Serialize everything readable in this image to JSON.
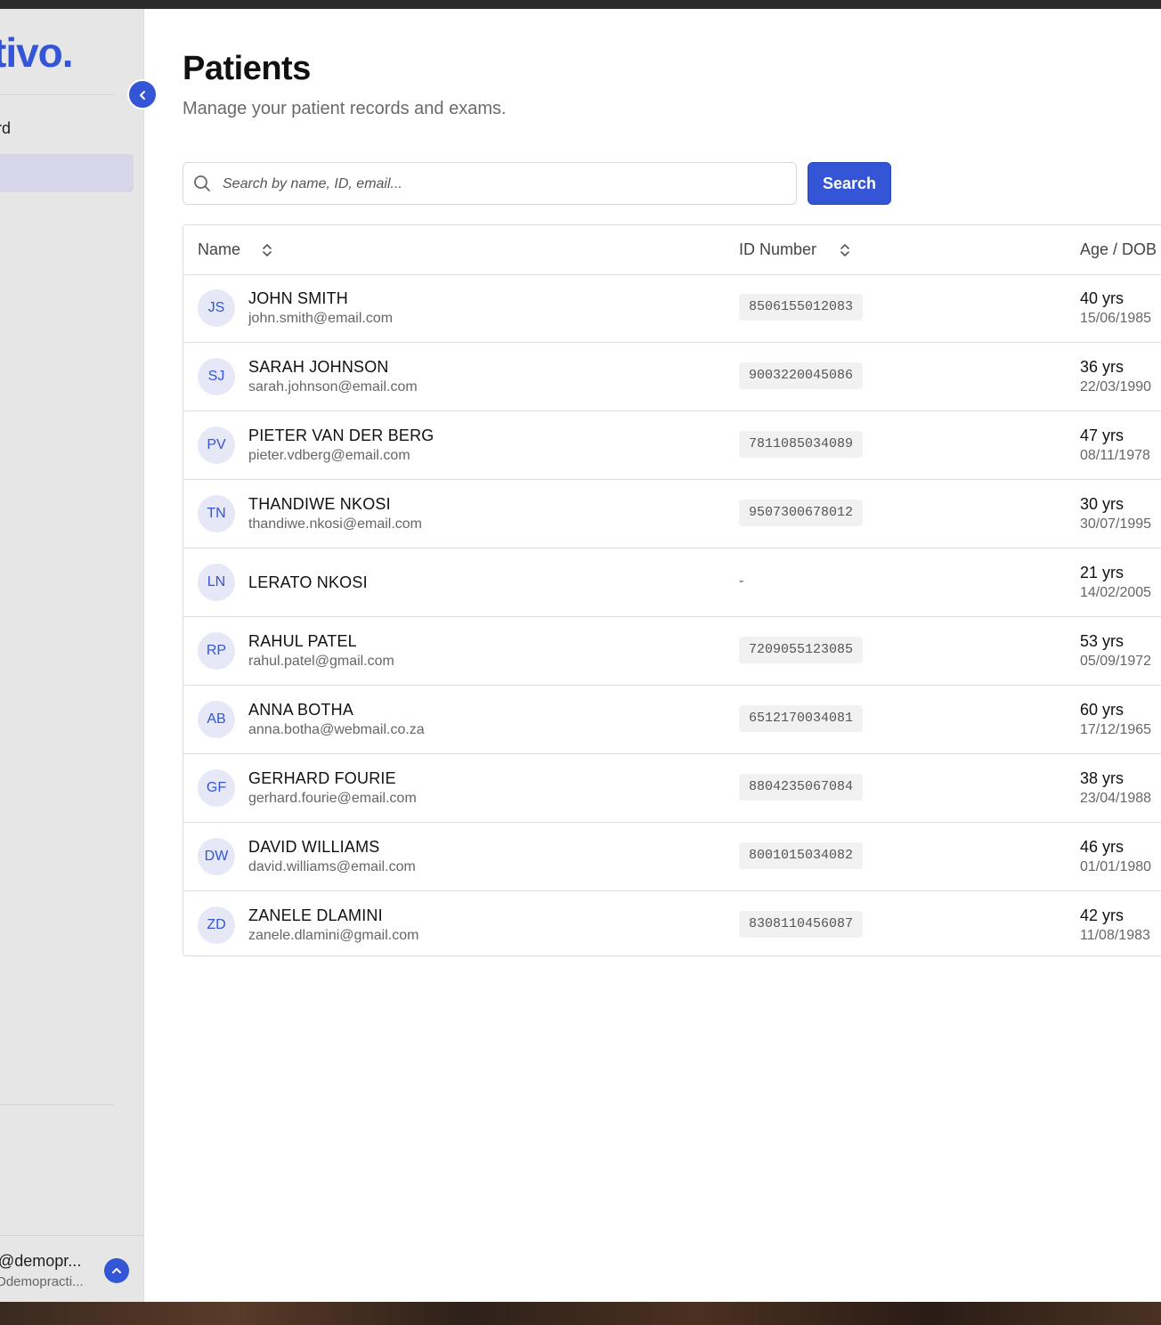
{
  "brand": {
    "logo_text": "tivo."
  },
  "sidebar": {
    "items": [
      {
        "label": "rd"
      }
    ],
    "user": {
      "email": "@demopr...",
      "sub": "Ddemopracti..."
    }
  },
  "page": {
    "title": "Patients",
    "subtitle": "Manage your patient records and exams."
  },
  "search": {
    "placeholder": "Search by name, ID, email...",
    "button_label": "Search"
  },
  "table": {
    "columns": [
      "Name",
      "ID Number",
      "Age / DOB"
    ],
    "rows": [
      {
        "initials": "JS",
        "name": "JOHN SMITH",
        "email": "john.smith@email.com",
        "id": "8506155012083",
        "age": "40 yrs",
        "dob": "15/06/1985"
      },
      {
        "initials": "SJ",
        "name": "SARAH JOHNSON",
        "email": "sarah.johnson@email.com",
        "id": "9003220045086",
        "age": "36 yrs",
        "dob": "22/03/1990"
      },
      {
        "initials": "PV",
        "name": "PIETER VAN DER BERG",
        "email": "pieter.vdberg@email.com",
        "id": "7811085034089",
        "age": "47 yrs",
        "dob": "08/11/1978"
      },
      {
        "initials": "TN",
        "name": "THANDIWE NKOSI",
        "email": "thandiwe.nkosi@email.com",
        "id": "9507300678012",
        "age": "30 yrs",
        "dob": "30/07/1995"
      },
      {
        "initials": "LN",
        "name": "LERATO NKOSI",
        "email": "",
        "id": "-",
        "age": "21 yrs",
        "dob": "14/02/2005"
      },
      {
        "initials": "RP",
        "name": "RAHUL PATEL",
        "email": "rahul.patel@gmail.com",
        "id": "7209055123085",
        "age": "53 yrs",
        "dob": "05/09/1972"
      },
      {
        "initials": "AB",
        "name": "ANNA BOTHA",
        "email": "anna.botha@webmail.co.za",
        "id": "6512170034081",
        "age": "60 yrs",
        "dob": "17/12/1965"
      },
      {
        "initials": "GF",
        "name": "GERHARD FOURIE",
        "email": "gerhard.fourie@email.com",
        "id": "8804235067084",
        "age": "38 yrs",
        "dob": "23/04/1988"
      },
      {
        "initials": "DW",
        "name": "DAVID WILLIAMS",
        "email": "david.williams@email.com",
        "id": "8001015034082",
        "age": "46 yrs",
        "dob": "01/01/1980"
      },
      {
        "initials": "ZD",
        "name": "ZANELE DLAMINI",
        "email": "zanele.dlamini@gmail.com",
        "id": "8308110456087",
        "age": "42 yrs",
        "dob": "11/08/1983"
      }
    ]
  },
  "icons": {
    "collapse": "chevron-left-icon",
    "search": "search-icon",
    "sort": "sort-icon",
    "user_menu": "chevron-up-icon"
  },
  "colors": {
    "accent": "#3355d6",
    "avatar_bg": "#e6e8f8",
    "sidebar_bg": "#e6e6e6",
    "active_item_bg": "#d6d6e8"
  }
}
